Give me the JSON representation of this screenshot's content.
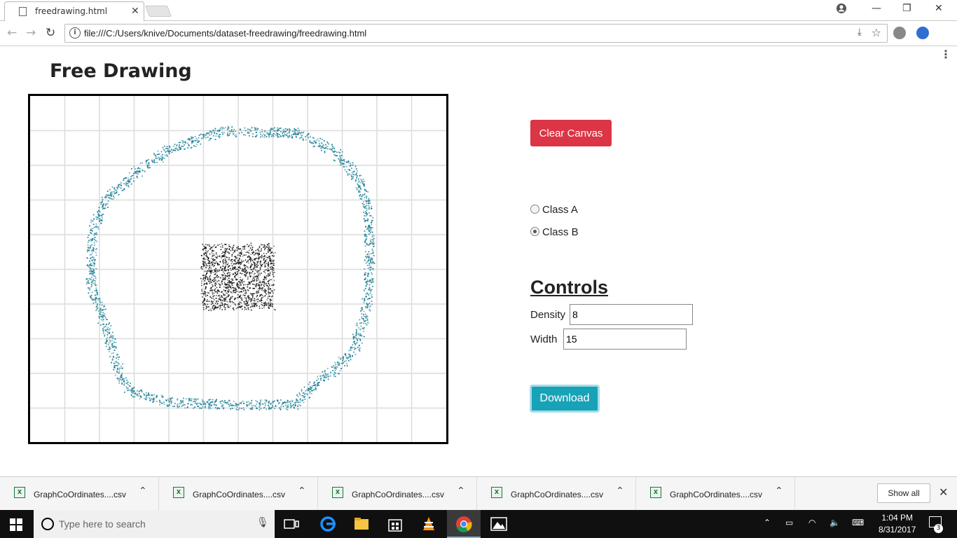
{
  "browser": {
    "tab_title": "freedrawing.html",
    "url": "file:///C:/Users/knive/Documents/dataset-freedrawing/freedrawing.html"
  },
  "page": {
    "title": "Free Drawing",
    "clear_button": "Clear Canvas",
    "classes": [
      {
        "label": "Class A",
        "checked": false
      },
      {
        "label": "Class B",
        "checked": true
      }
    ],
    "controls_heading": "Controls",
    "density_label": "Density",
    "density_value": "8",
    "width_label": "Width",
    "width_value": "15",
    "download_button": "Download",
    "colors": {
      "class_a": "#000000",
      "class_b": "#1b7f95",
      "clear": "#dc3545",
      "download": "#17a2b8"
    }
  },
  "downloads": {
    "items": [
      "GraphCoOrdinates....csv",
      "GraphCoOrdinates....csv",
      "GraphCoOrdinates....csv",
      "GraphCoOrdinates....csv",
      "GraphCoOrdinates....csv"
    ],
    "show_all": "Show all"
  },
  "taskbar": {
    "search_placeholder": "Type here to search",
    "time": "1:04 PM",
    "date": "8/31/2017",
    "notification_count": "3"
  }
}
